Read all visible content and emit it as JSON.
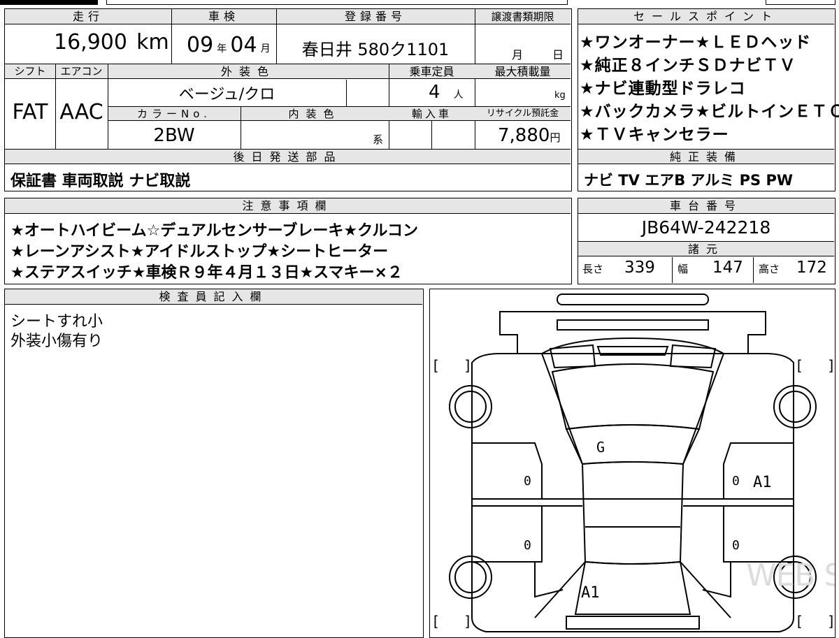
{
  "headers": {
    "mileage": "走行",
    "inspection": "車検",
    "registration": "登録番号",
    "transfer_deadline": "譲渡書類期限",
    "shift": "シフト",
    "aircon": "エアコン",
    "exterior_color": "外装色",
    "capacity": "乗車定員",
    "max_load": "最大積載量",
    "color_no": "カラーNo.",
    "interior_color": "内装色",
    "import": "輸入車",
    "recycle": "リサイクル預託金",
    "later_parts": "後日発送部品",
    "sales_points": "セールスポイント",
    "standard_equipment": "純正装備",
    "caution": "注意事項欄",
    "chassis_no": "車台番号",
    "specs": "諸元",
    "inspector": "検査員記入欄"
  },
  "vehicle": {
    "mileage_value": "16,900",
    "mileage_unit": "km",
    "inspection_year": "09",
    "year_unit": "年",
    "inspection_month": "04",
    "month_unit": "月",
    "registration_number": "春日井 580ク1101",
    "transfer_month_unit": "月",
    "transfer_day_unit": "日",
    "shift": "FAT",
    "aircon": "AAC",
    "exterior_color": "ベージュ/クロ",
    "capacity_value": "4",
    "capacity_unit": "人",
    "load_unit": "kg",
    "color_no": "2BW",
    "interior_suffix": "系",
    "recycle_fee": "7,880",
    "recycle_unit": "円",
    "chassis_number": "JB64W-242218"
  },
  "later_parts": "保証書 車両取説 ナビ取説",
  "sales_points": [
    "★ワンオーナー★ＬＥＤヘッド",
    "★純正８インチＳＤナビＴＶ",
    "★ナビ連動型ドラレコ",
    "★バックカメラ★ビルトインＥＴＣ",
    "★ＴＶキャンセラー"
  ],
  "standard_equipment": "ナビ TV エアB アルミ PS PW",
  "caution_lines": [
    "★オートハイビーム☆デュアルセンサーブレーキ★クルコン",
    "★レーンアシスト★アイドルストップ★シートヒーター",
    "★ステアスイッチ★車検Ｒ９年４月１３日★スマキー×２"
  ],
  "specs": {
    "length_label": "長さ",
    "length_value": "339",
    "width_label": "幅",
    "width_value": "147",
    "height_label": "高さ",
    "height_value": "172"
  },
  "inspector_notes": [
    "シートすれ小",
    "外装小傷有り"
  ],
  "diagram_marks": {
    "hood": "G",
    "left_front_door": "0",
    "left_rear_door": "0",
    "right_front_door": "0",
    "right_front_door_grade": "A1",
    "right_rear_door": "0",
    "rear": "A1"
  },
  "watermark": "WEB STUDIO PRO"
}
